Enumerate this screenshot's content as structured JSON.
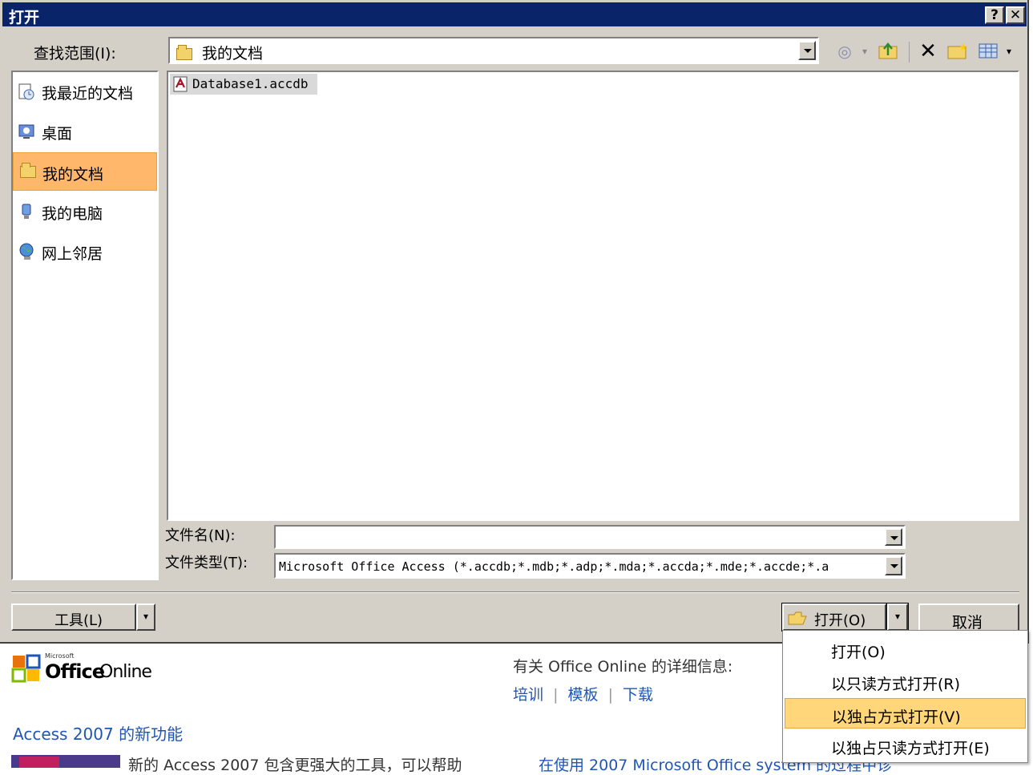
{
  "dialog": {
    "title": "打开",
    "help_button": "?",
    "close_button": "✕",
    "look_in_label": "查找范围(I):",
    "look_in_value": "我的文档",
    "places": [
      {
        "label": "我最近的文档",
        "icon": "recent-documents-icon"
      },
      {
        "label": "桌面",
        "icon": "desktop-icon"
      },
      {
        "label": "我的文档",
        "icon": "my-documents-folder-icon",
        "selected": true
      },
      {
        "label": "我的电脑",
        "icon": "my-computer-icon"
      },
      {
        "label": "网上邻居",
        "icon": "network-places-icon"
      }
    ],
    "files": [
      {
        "name": "Database1.accdb",
        "icon": "access-database-icon"
      }
    ],
    "file_name_label": "文件名(N):",
    "file_name_value": "",
    "file_type_label": "文件类型(T):",
    "file_type_value": "Microsoft Office Access (*.accdb;*.mdb;*.adp;*.mda;*.accda;*.mde;*.accde;*.a",
    "tools_button": "工具(L)",
    "open_button": "打开(O)",
    "cancel_button": "取消",
    "accent_color": "#0a246a",
    "selection_color": "#ffb76b"
  },
  "open_menu": {
    "items": [
      {
        "label": "打开(O)"
      },
      {
        "label": "以只读方式打开(R)"
      },
      {
        "label": "以独占方式打开(V)",
        "highlighted": true
      },
      {
        "label": "以独占只读方式打开(E)"
      }
    ]
  },
  "background_page": {
    "brand_small": "Microsoft",
    "brand_office": "Office",
    "brand_online": "Online",
    "info_label": "有关 Office Online 的详细信息:",
    "links": [
      "培训",
      "模板",
      "下载"
    ],
    "whats_new": "Access 2007 的新功能",
    "body_text_left": "新的 Access 2007 包含更强大的工具，可以帮助",
    "body_text_right": "在使用 2007 Microsoft Office system 的过程中诊"
  }
}
